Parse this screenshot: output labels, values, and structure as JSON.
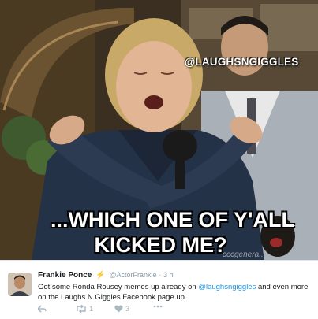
{
  "meme": {
    "watermark": "@LAUGHSNGIGGLES",
    "caption_line_1": "...WHICH ONE OF Y'ALL",
    "caption_line_2": "KICKED ME?",
    "corner_mark": "cccgenera..."
  },
  "tweet": {
    "author_name": "Frankie Ponce",
    "verified_icon": "lightning-bolt-icon",
    "handle": "@ActorFrankie",
    "separator": "·",
    "timestamp": "3 h",
    "text_part_1": "Got some Ronda Rousey memes up already on ",
    "mention": "@laughsngiggles",
    "text_part_2": " and even more on the Laughs N Giggles Facebook page up.",
    "actions": {
      "reply_icon": "reply-arrow-icon",
      "retweet_icon": "retweet-icon",
      "retweet_count": "1",
      "like_icon": "heart-icon",
      "like_count": "3",
      "more_icon": "more-dots-icon"
    }
  },
  "colors": {
    "link": "#1b95e0",
    "bolt": "#f6a623",
    "muted": "#8899a6"
  }
}
